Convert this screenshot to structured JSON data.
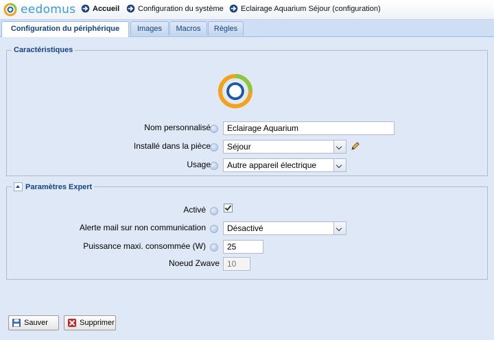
{
  "header": {
    "logo_text": "eedomus",
    "breadcrumbs": [
      "Accueil",
      "Configuration du système",
      "Eclairage Aquarium Séjour (configuration)"
    ]
  },
  "tabs": [
    "Configuration du périphérique",
    "Images",
    "Macros",
    "Règles"
  ],
  "active_tab": 0,
  "caracteristiques": {
    "legend": "Caractéristiques",
    "name_label": "Nom personnalisé",
    "name_value": "Eclairage Aquarium",
    "room_label": "Installé dans la pièce",
    "room_value": "Séjour",
    "usage_label": "Usage",
    "usage_value": "Autre appareil électrique"
  },
  "expert": {
    "legend": "Paramètres Expert",
    "active_label": "Activé",
    "active_checked": true,
    "alert_label": "Alerte mail sur non communication",
    "alert_value": "Désactivé",
    "power_label": "Puissance maxi. consommée (W)",
    "power_value": "25",
    "zwave_label": "Noeud Zwave",
    "zwave_value": "10"
  },
  "actions": {
    "save_label": "Sauver",
    "delete_label": "Supprimer"
  },
  "colors": {
    "panel_bg": "#dfe8f6",
    "legend_text": "#15428b",
    "logo_orange": "#f2a31b",
    "logo_green": "#8cc63f",
    "logo_blue": "#1c5aa6"
  }
}
